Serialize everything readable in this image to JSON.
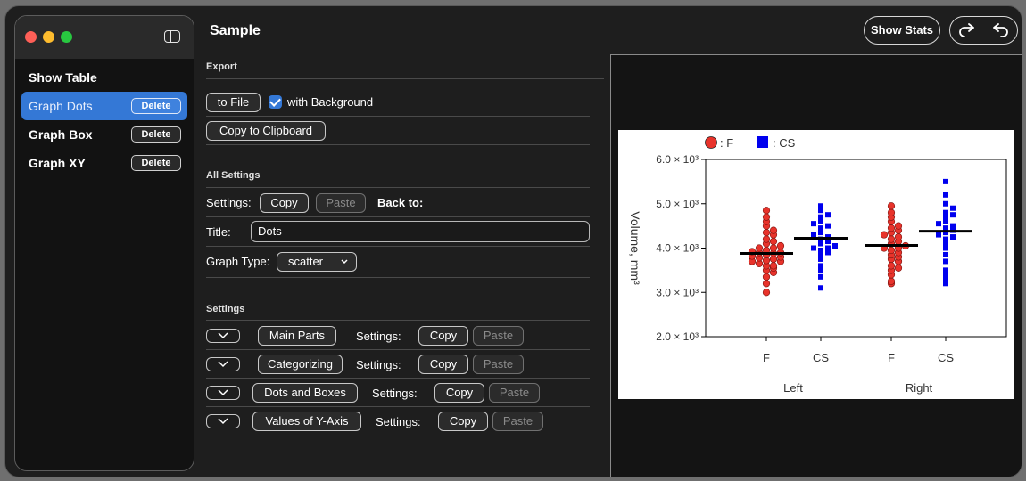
{
  "sidebar": {
    "items": [
      {
        "label": "Show Table",
        "delete": ""
      },
      {
        "label": "Graph Dots",
        "delete": "Delete",
        "selected": true
      },
      {
        "label": "Graph Box",
        "delete": "Delete"
      },
      {
        "label": "Graph XY",
        "delete": "Delete"
      }
    ]
  },
  "header": {
    "title": "Sample",
    "show_stats": "Show Stats"
  },
  "export": {
    "section": "Export",
    "to_file": "to File",
    "with_background": "with Background",
    "with_background_checked": true,
    "copy_clipboard": "Copy to Clipboard"
  },
  "all_settings": {
    "section": "All Settings",
    "settings_label": "Settings:",
    "copy": "Copy",
    "paste": "Paste",
    "back_to": "Back to:",
    "title_label": "Title:",
    "title_value": "Dots",
    "graph_type_label": "Graph Type:",
    "graph_type_value": "scatter"
  },
  "settings": {
    "section": "Settings",
    "rows": [
      {
        "name": "Main Parts",
        "label": "Settings:",
        "copy": "Copy",
        "paste": "Paste"
      },
      {
        "name": "Categorizing",
        "label": "Settings:",
        "copy": "Copy",
        "paste": "Paste"
      },
      {
        "name": "Dots and Boxes",
        "label": "Settings:",
        "copy": "Copy",
        "paste": "Paste"
      },
      {
        "name": "Values of Y-Axis",
        "label": "Settings:",
        "copy": "Copy",
        "paste": "Paste"
      }
    ]
  },
  "colors": {
    "accent": "#3478d6",
    "series_f": "#e8332b",
    "series_cs": "#0000ee"
  },
  "chart_data": {
    "type": "scatter",
    "ylabel": "Volume, mm³",
    "ylim": [
      2.0,
      6.0
    ],
    "yticks": [
      "2.0 × 10³",
      "3.0 × 10³",
      "4.0 × 10³",
      "5.0 × 10³",
      "6.0 × 10³"
    ],
    "ytick_values": [
      2.0,
      3.0,
      4.0,
      5.0,
      6.0
    ],
    "groups": [
      "Left",
      "Right"
    ],
    "categories": [
      "F",
      "CS",
      "F",
      "CS"
    ],
    "legend": [
      {
        "marker": "circle",
        "label": ": F"
      },
      {
        "marker": "square",
        "label": ": CS"
      }
    ],
    "legend_position": "top-left",
    "grid": false,
    "series": [
      {
        "name": "F",
        "category": 0,
        "means": 3.88,
        "values": [
          3.0,
          3.2,
          3.35,
          3.45,
          3.55,
          3.6,
          3.65,
          3.7,
          3.72,
          3.75,
          3.78,
          3.8,
          3.82,
          3.85,
          3.88,
          3.9,
          3.92,
          3.95,
          4.0,
          4.05,
          4.1,
          4.15,
          4.2,
          4.3,
          4.35,
          4.4,
          4.5,
          4.6,
          4.7,
          4.85,
          3.7,
          3.5,
          3.9,
          4.0,
          3.6
        ]
      },
      {
        "name": "CS",
        "category": 1,
        "means": 4.22,
        "values": [
          3.1,
          3.35,
          3.5,
          3.6,
          3.75,
          3.85,
          3.95,
          4.0,
          4.05,
          4.1,
          4.15,
          4.2,
          4.25,
          4.3,
          4.35,
          4.45,
          4.5,
          4.6,
          4.7,
          4.75,
          4.85,
          4.95,
          4.55,
          4.0,
          3.9
        ]
      },
      {
        "name": "F",
        "category": 2,
        "means": 4.06,
        "values": [
          3.2,
          3.25,
          3.4,
          3.5,
          3.6,
          3.7,
          3.8,
          3.85,
          3.9,
          3.95,
          4.0,
          4.05,
          4.1,
          4.15,
          4.2,
          4.25,
          4.3,
          4.4,
          4.5,
          4.6,
          4.7,
          4.8,
          4.95,
          3.75,
          4.0,
          4.45,
          3.55,
          4.35
        ]
      },
      {
        "name": "CS",
        "category": 3,
        "means": 4.38,
        "values": [
          3.2,
          3.3,
          3.4,
          3.5,
          3.7,
          3.85,
          4.0,
          4.1,
          4.2,
          4.3,
          4.35,
          4.4,
          4.5,
          4.55,
          4.6,
          4.7,
          4.75,
          4.8,
          4.9,
          5.0,
          5.2,
          5.5,
          4.45,
          4.25
        ]
      }
    ]
  }
}
